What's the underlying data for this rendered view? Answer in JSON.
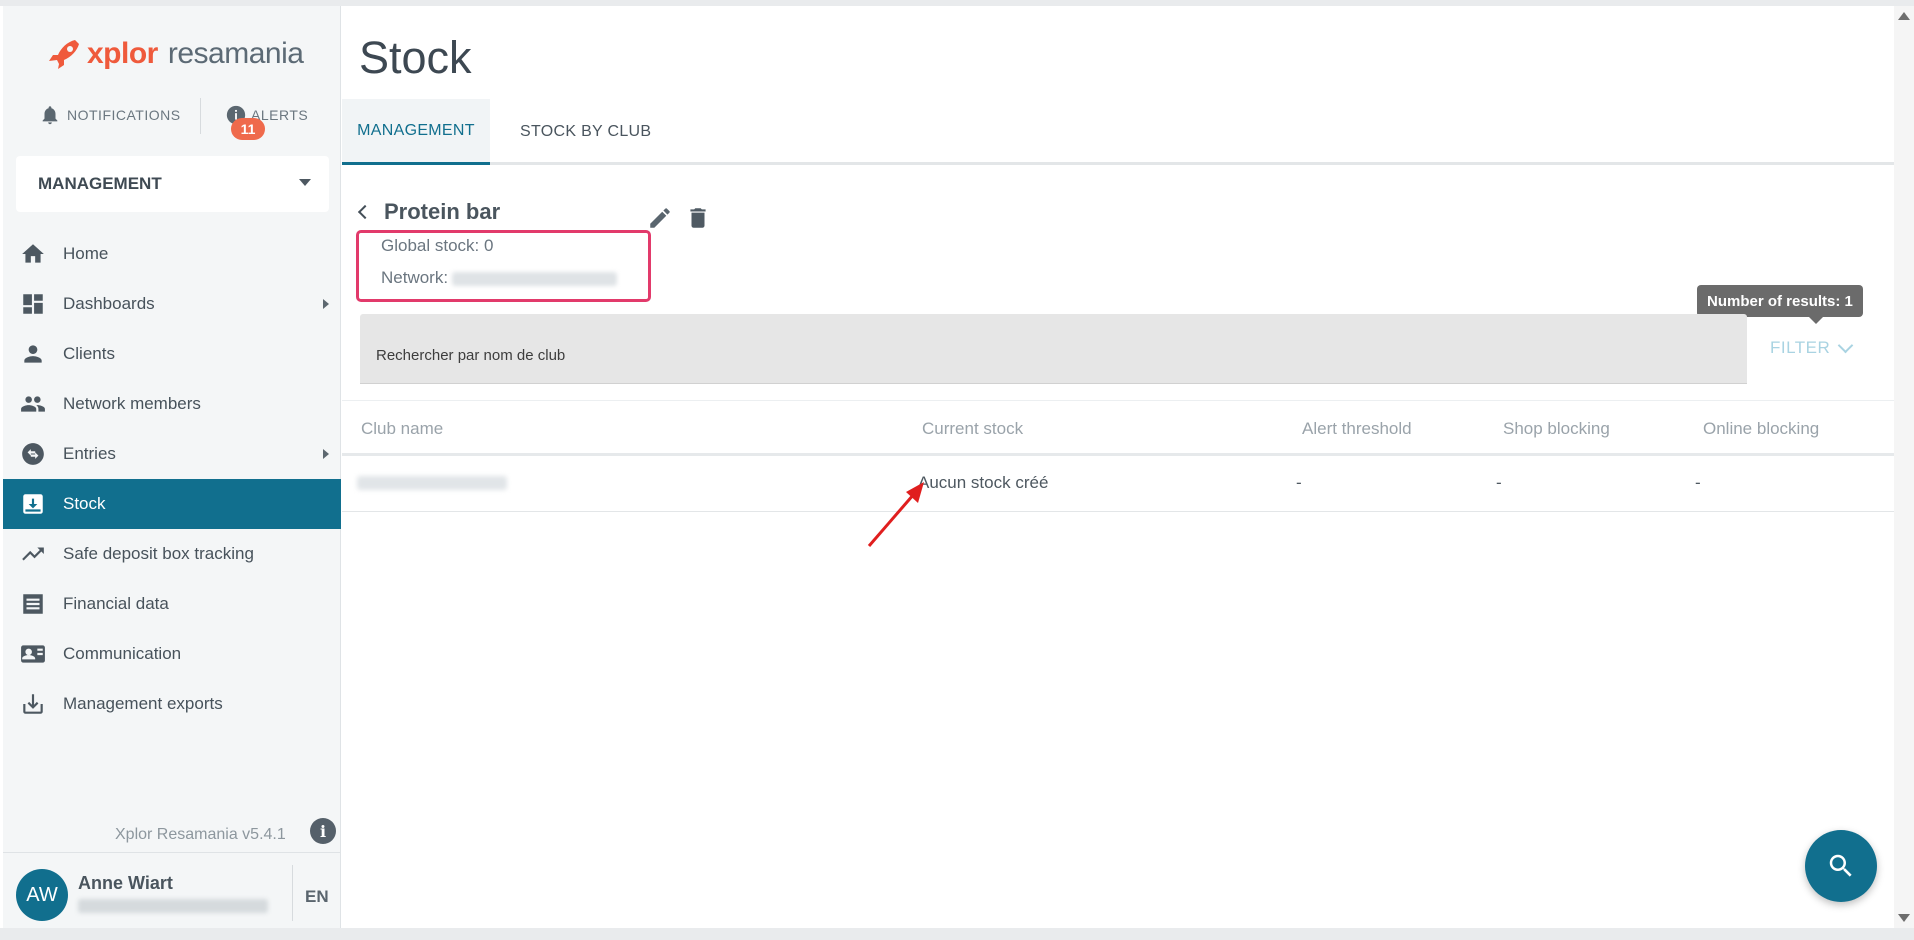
{
  "brand": {
    "logo_main": "xplor",
    "logo_sub": "resamania"
  },
  "header": {
    "notifications_label": "NOTIFICATIONS",
    "alerts_label": "ALERTS",
    "alerts_count": "11"
  },
  "context_select": {
    "value": "MANAGEMENT"
  },
  "sidebar": {
    "items": [
      {
        "label": "Home",
        "icon": "home-icon",
        "submenu": false,
        "active": false
      },
      {
        "label": "Dashboards",
        "icon": "dashboard-icon",
        "submenu": true,
        "active": false
      },
      {
        "label": "Clients",
        "icon": "person-icon",
        "submenu": false,
        "active": false
      },
      {
        "label": "Network members",
        "icon": "people-icon",
        "submenu": false,
        "active": false
      },
      {
        "label": "Entries",
        "icon": "swap-icon",
        "submenu": true,
        "active": false
      },
      {
        "label": "Stock",
        "icon": "inbox-icon",
        "submenu": false,
        "active": true
      },
      {
        "label": "Safe deposit box tracking",
        "icon": "trending-up-icon",
        "submenu": false,
        "active": false
      },
      {
        "label": "Financial data",
        "icon": "receipt-icon",
        "submenu": false,
        "active": false
      },
      {
        "label": "Communication",
        "icon": "contact-card-icon",
        "submenu": false,
        "active": false
      },
      {
        "label": "Management exports",
        "icon": "download-icon",
        "submenu": false,
        "active": false
      }
    ],
    "version": "Xplor Resamania v5.4.1"
  },
  "user": {
    "initials": "AW",
    "name": "Anne Wiart",
    "language": "EN"
  },
  "main": {
    "page_title": "Stock",
    "tabs": [
      {
        "label": "MANAGEMENT",
        "active": true
      },
      {
        "label": "STOCK BY CLUB",
        "active": false
      }
    ],
    "product": {
      "name": "Protein bar",
      "global_stock": "Global stock: 0",
      "network_label": "Network:"
    },
    "results_tooltip": "Number of results: 1",
    "search": {
      "placeholder": "Rechercher par nom de club",
      "value": ""
    },
    "filter_label": "FILTER",
    "table": {
      "columns": [
        "Club name",
        "Current stock",
        "Alert threshold",
        "Shop blocking",
        "Online blocking"
      ],
      "rows": [
        {
          "current_stock": "Aucun stock créé",
          "alert_threshold": "-",
          "shop_blocking": "-",
          "online_blocking": "-"
        }
      ]
    }
  },
  "colors": {
    "accent": "#116f8e",
    "brand_orange": "#ef5a3c",
    "highlight": "#e23a6b",
    "annotation_arrow": "#e01e1e"
  }
}
